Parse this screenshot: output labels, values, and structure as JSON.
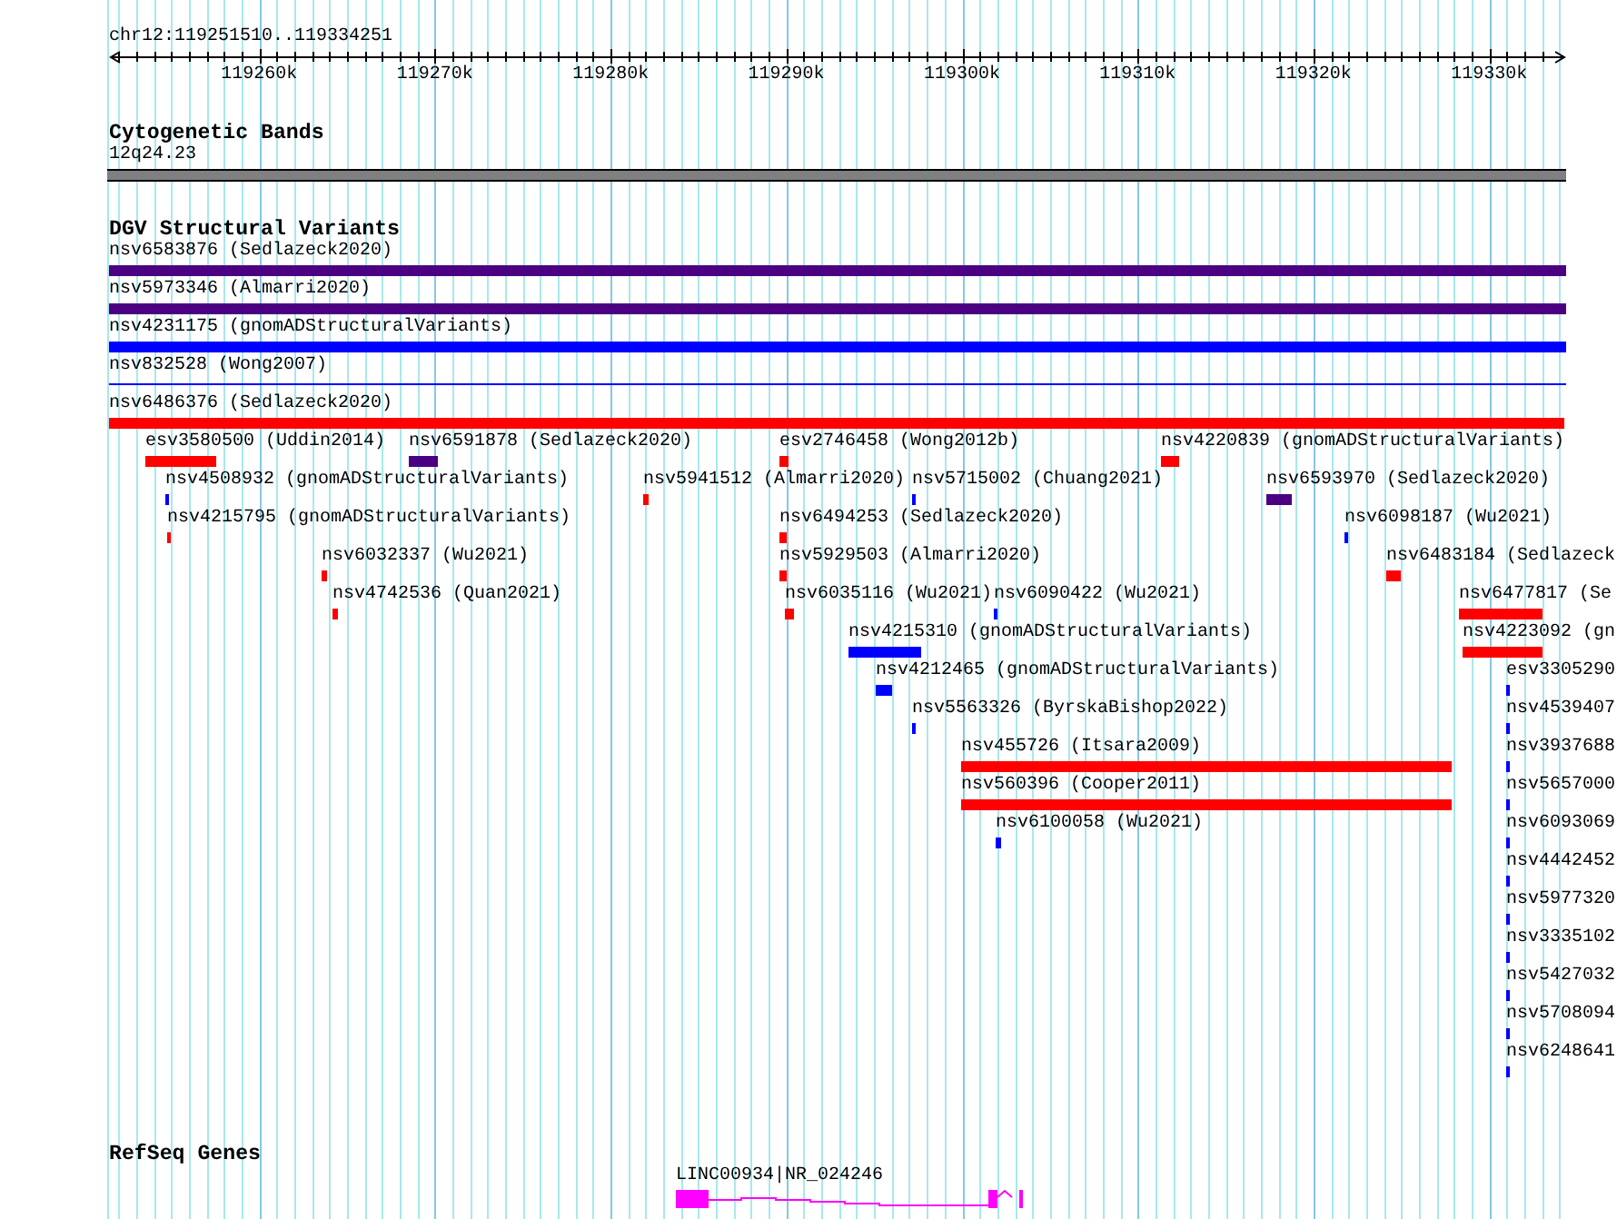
{
  "ruler": {
    "location": "chr12:119251510..119334251",
    "ticks": [
      "119260k",
      "119270k",
      "119280k",
      "119290k",
      "119300k",
      "119310k",
      "119320k",
      "119330k"
    ]
  },
  "tracks": [
    {
      "kind": "cytoband",
      "title": "Cytogenetic Bands",
      "features": [
        {
          "label": "12q24.23"
        }
      ]
    },
    {
      "kind": "variants",
      "title": "DGV Structural Variants",
      "features": [
        {
          "label": "nsv6583876 (Sedlazeck2020)",
          "kind": "bar",
          "color": "#4b0082"
        },
        {
          "label": "nsv5973346 (Almarri2020)",
          "kind": "bar",
          "color": "#4b0082"
        },
        {
          "label": "nsv4231175 (gnomADStructuralVariants)",
          "kind": "bar",
          "color": "#0000ff"
        },
        {
          "label": "nsv832528 (Wong2007)",
          "kind": "line",
          "color": "#0000ff"
        },
        {
          "label": "nsv6486376 (Sedlazeck2020)",
          "kind": "bar",
          "color": "#ff0000"
        },
        {
          "label": "esv3580500 (Uddin2014)",
          "kind": "bar",
          "color": "#ff0000"
        },
        {
          "label": "nsv6591878 (Sedlazeck2020)",
          "kind": "bar",
          "color": "#4b0082"
        },
        {
          "label": "esv2746458 (Wong2012b)",
          "kind": "bar",
          "color": "#ff0000"
        },
        {
          "label": "nsv4220839 (gnomADStructuralVariants)",
          "kind": "bar",
          "color": "#ff0000"
        },
        {
          "label": "nsv4508932 (gnomADStructuralVariants)",
          "kind": "bar",
          "color": "#0000ff"
        },
        {
          "label": "nsv5941512 (Almarri2020)",
          "kind": "bar",
          "color": "#ff0000"
        },
        {
          "label": "nsv5715002 (Chuang2021)",
          "kind": "bar",
          "color": "#0000ff"
        },
        {
          "label": "nsv6593970 (Sedlazeck2020)",
          "kind": "bar",
          "color": "#4b0082"
        },
        {
          "label": "nsv4215795 (gnomADStructuralVariants)",
          "kind": "bar",
          "color": "#ff0000"
        },
        {
          "label": "nsv6494253 (Sedlazeck2020)",
          "kind": "bar",
          "color": "#ff0000"
        },
        {
          "label": "nsv6098187 (Wu2021)",
          "kind": "bar",
          "color": "#0000ff"
        },
        {
          "label": "nsv6032337 (Wu2021)",
          "kind": "bar",
          "color": "#ff0000"
        },
        {
          "label": "nsv5929503 (Almarri2020)",
          "kind": "bar",
          "color": "#ff0000"
        },
        {
          "label": "nsv6483184 (Sedlazeck",
          "kind": "bar",
          "color": "#ff0000"
        },
        {
          "label": "nsv4742536 (Quan2021)",
          "kind": "bar",
          "color": "#ff0000"
        },
        {
          "label": "nsv6035116 (Wu2021)",
          "kind": "bar",
          "color": "#ff0000"
        },
        {
          "label": "nsv6090422 (Wu2021)",
          "kind": "bar",
          "color": "#0000ff"
        },
        {
          "label": "nsv6477817 (Se",
          "kind": "bar",
          "color": "#ff0000"
        },
        {
          "label": "nsv4215310 (gnomADStructuralVariants)",
          "kind": "bar",
          "color": "#0000ff"
        },
        {
          "label": "nsv4223092 (gn",
          "kind": "bar",
          "color": "#ff0000"
        },
        {
          "label": "nsv4212465 (gnomADStructuralVariants)",
          "kind": "bar",
          "color": "#0000ff"
        },
        {
          "label": "esv3305290",
          "kind": "bar",
          "color": "#0000ff"
        },
        {
          "label": "nsv5563326 (ByrskaBishop2022)",
          "kind": "bar",
          "color": "#0000ff"
        },
        {
          "label": "nsv4539407",
          "kind": "bar",
          "color": "#0000ff"
        },
        {
          "label": "nsv455726 (Itsara2009)",
          "kind": "bar",
          "color": "#ff0000"
        },
        {
          "label": "nsv3937688",
          "kind": "bar",
          "color": "#0000ff"
        },
        {
          "label": "nsv560396 (Cooper2011)",
          "kind": "bar",
          "color": "#ff0000"
        },
        {
          "label": "nsv5657000",
          "kind": "bar",
          "color": "#0000ff"
        },
        {
          "label": "nsv6100058 (Wu2021)",
          "kind": "bar",
          "color": "#0000ff"
        },
        {
          "label": "nsv6093069",
          "kind": "bar",
          "color": "#0000ff"
        },
        {
          "label": "nsv4442452",
          "kind": "bar",
          "color": "#0000ff"
        },
        {
          "label": "nsv5977320",
          "kind": "bar",
          "color": "#0000ff"
        },
        {
          "label": "nsv3335102",
          "kind": "bar",
          "color": "#0000ff"
        },
        {
          "label": "nsv5427032",
          "kind": "bar",
          "color": "#0000ff"
        },
        {
          "label": "nsv5708094",
          "kind": "bar",
          "color": "#0000ff"
        },
        {
          "label": "nsv6248641",
          "kind": "bar",
          "color": "#0000ff"
        }
      ]
    },
    {
      "kind": "genes",
      "title": "RefSeq Genes",
      "features": [
        {
          "label": "LINC00934|NR_024246"
        }
      ]
    }
  ]
}
